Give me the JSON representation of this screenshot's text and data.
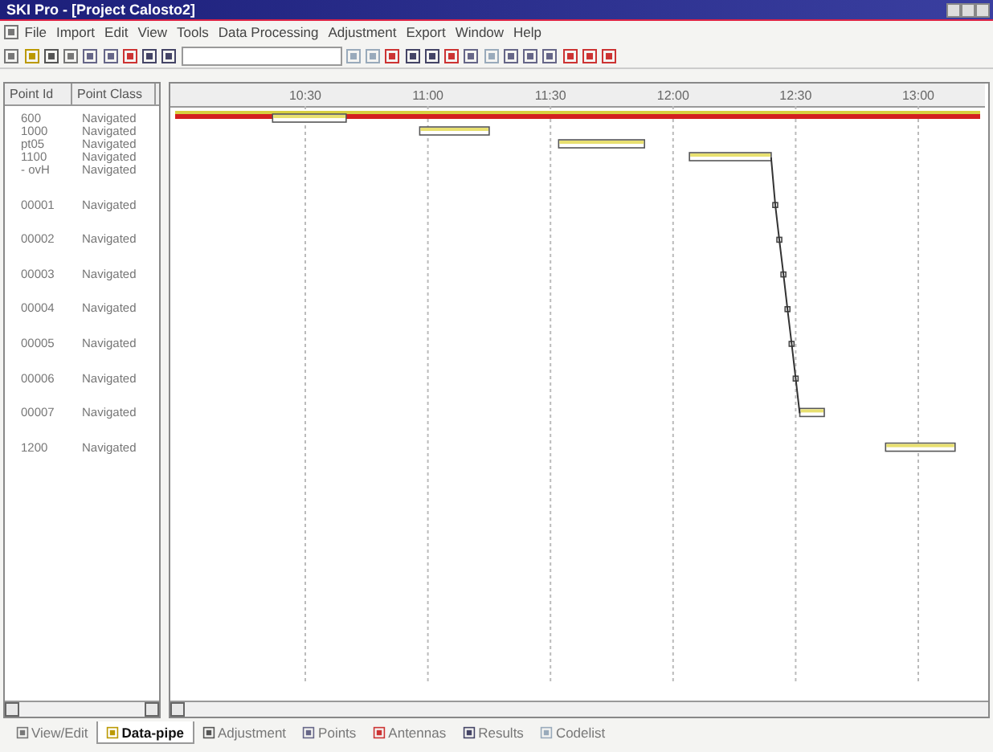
{
  "window": {
    "title": "SKI Pro - [Project Calosto2]"
  },
  "menu": [
    "File",
    "Import",
    "Edit",
    "View",
    "Tools",
    "Data Processing",
    "Adjustment",
    "Export",
    "Window",
    "Help"
  ],
  "points": {
    "columns": [
      "Point Id",
      "Point Class"
    ],
    "rows": [
      {
        "id": "600",
        "class": "Navigated"
      },
      {
        "id": "1000",
        "class": "Navigated"
      },
      {
        "id": "pt05",
        "class": "Navigated"
      },
      {
        "id": "1100",
        "class": "Navigated"
      },
      {
        "id": "- ovH",
        "class": "Navigated"
      },
      {
        "id": "00001",
        "class": "Navigated"
      },
      {
        "id": "00002",
        "class": "Navigated"
      },
      {
        "id": "00003",
        "class": "Navigated"
      },
      {
        "id": "00004",
        "class": "Navigated"
      },
      {
        "id": "00005",
        "class": "Navigated"
      },
      {
        "id": "00006",
        "class": "Navigated"
      },
      {
        "id": "00007",
        "class": "Navigated"
      },
      {
        "id": "1200",
        "class": "Navigated"
      }
    ]
  },
  "time_axis": [
    "10:30",
    "11:00",
    "11:30",
    "12:00",
    "12:30",
    "13:00"
  ],
  "tabs": [
    {
      "label": "View/Edit",
      "selected": false
    },
    {
      "label": "Data-pipe",
      "selected": true
    },
    {
      "label": "Adjustment",
      "selected": false
    },
    {
      "label": "Points",
      "selected": false
    },
    {
      "label": "Antennas",
      "selected": false
    },
    {
      "label": "Results",
      "selected": false
    },
    {
      "label": "Codelist",
      "selected": false
    }
  ]
}
